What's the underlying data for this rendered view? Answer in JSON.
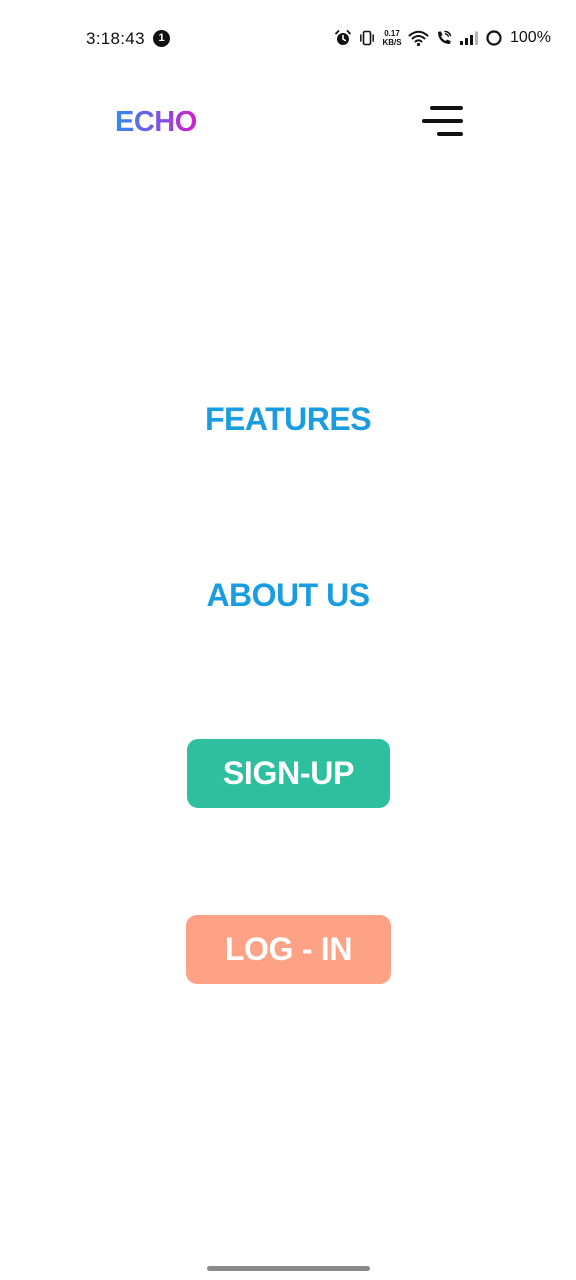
{
  "status_bar": {
    "time": "3:18:43",
    "notification_count": "1",
    "net_speed_value": "0.17",
    "net_speed_unit": "KB/S",
    "battery": "100%"
  },
  "header": {
    "logo": "ECHO",
    "menu_icon": "hamburger-menu-icon"
  },
  "nav": {
    "features": "FEATURES",
    "about_us": "ABOUT US",
    "sign_up": "SIGN-UP",
    "log_in": "LOG - IN"
  },
  "colors": {
    "link": "#1a9de0",
    "signup_bg": "#2ebf9f",
    "login_bg": "#fea286",
    "logo_gradient_start": "#2f8cf0",
    "logo_gradient_end": "#d21fc9"
  }
}
